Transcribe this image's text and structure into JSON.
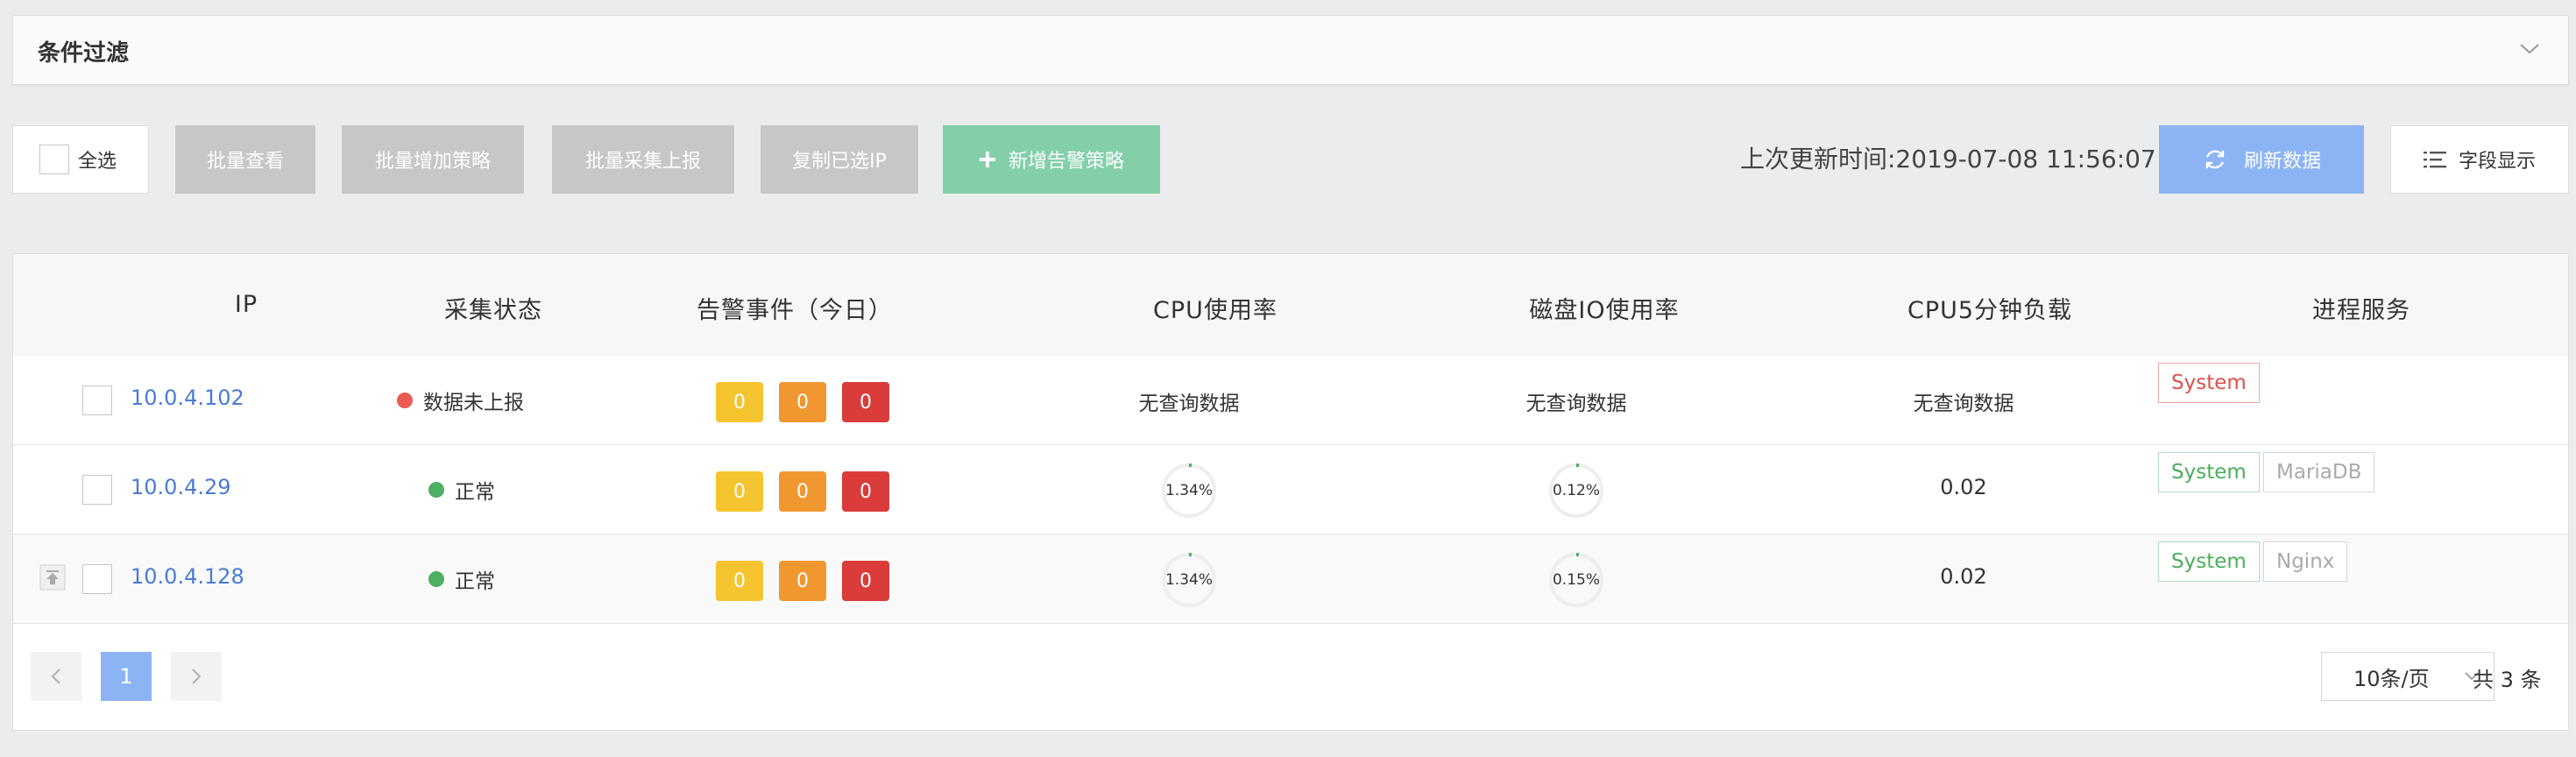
{
  "filter": {
    "title": "条件过滤",
    "chevron_icon": "chevron-down-icon"
  },
  "toolbar": {
    "select_all": "全选",
    "batch_view": "批量查看",
    "batch_add_policy": "批量增加策略",
    "batch_collect": "批量采集上报",
    "copy_ip": "复制已选IP",
    "add_alert_policy": "新增告警策略",
    "add_icon": "plus-icon",
    "update_time": "上次更新时间:2019-07-08 11:56:07",
    "refresh": "刷新数据",
    "refresh_icon": "refresh-icon",
    "fields": "字段显示",
    "fields_icon": "list-settings-icon"
  },
  "colors": {
    "accent_blue": "#8cb4f5",
    "accent_green": "#83cfa9",
    "link": "#4a7bd4",
    "alert_yellow": "#f5c42f",
    "alert_orange": "#f0982f",
    "alert_red": "#d93c3a",
    "status_red": "#ec5a53",
    "status_green": "#4caf62"
  },
  "table": {
    "headers": {
      "ip": "IP",
      "status": "采集状态",
      "alerts": "告警事件（今日）",
      "cpu": "CPU使用率",
      "disk": "磁盘IO使用率",
      "load": "CPU5分钟负载",
      "process": "进程服务"
    },
    "rows": [
      {
        "ip": "10.0.4.102",
        "status": "数据未上报",
        "status_color": "#ec5a53",
        "alerts": [
          "0",
          "0",
          "0"
        ],
        "cpu": "无查询数据",
        "disk": "无查询数据",
        "load": "无查询数据",
        "services": [
          "System"
        ]
      },
      {
        "ip": "10.0.4.29",
        "status": "正常",
        "status_color": "#4caf62",
        "alerts": [
          "0",
          "0",
          "0"
        ],
        "cpu": "1.34%",
        "cpu_value": 1.34,
        "disk": "0.12%",
        "disk_value": 0.12,
        "load": "0.02",
        "services": [
          "System",
          "MariaDB"
        ]
      },
      {
        "ip": "10.0.4.128",
        "status": "正常",
        "status_color": "#4caf62",
        "alerts": [
          "0",
          "0",
          "0"
        ],
        "cpu": "1.34%",
        "cpu_value": 1.34,
        "disk": "0.15%",
        "disk_value": 0.15,
        "load": "0.02",
        "services": [
          "System",
          "Nginx"
        ],
        "pin_icon": "pin-top-icon"
      }
    ]
  },
  "pagination": {
    "prev_icon": "chevron-left-icon",
    "current_page": "1",
    "next_icon": "chevron-right-icon",
    "page_size": "10条/页",
    "total": "共 3 条"
  }
}
